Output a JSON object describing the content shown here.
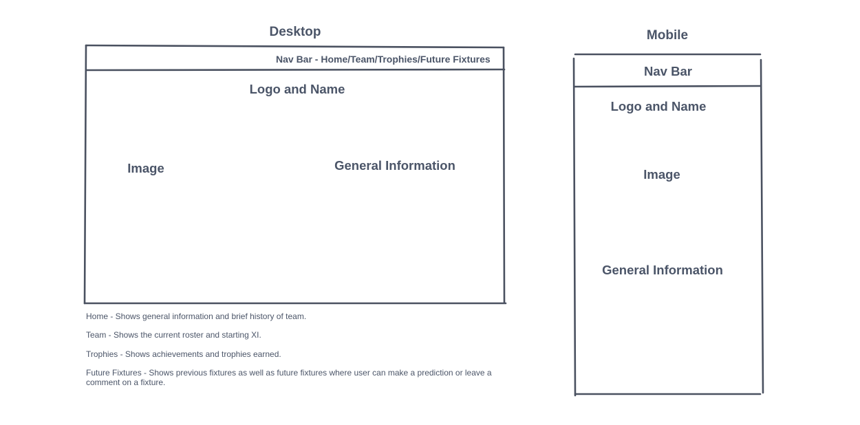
{
  "desktop": {
    "heading": "Desktop",
    "nav_bar": "Nav Bar - Home/Team/Trophies/Future Fixtures",
    "logo_and_name": "Logo and Name",
    "image": "Image",
    "general_information": "General Information"
  },
  "notes": {
    "home": "Home - Shows general information and brief history of team.",
    "team": "Team - Shows the current roster and starting XI.",
    "trophies": "Trophies - Shows achievements and trophies earned.",
    "future_fixtures": "Future Fixtures - Shows previous fixtures as well as future fixtures where user can make a prediction or leave a comment on a fixture."
  },
  "mobile": {
    "heading": "Mobile",
    "nav_bar": "Nav Bar",
    "logo_and_name": "Logo and Name",
    "image": "Image",
    "general_information": "General Information"
  },
  "colors": {
    "stroke": "#4a5160",
    "text": "#4b5568",
    "background": "#ffffff"
  }
}
